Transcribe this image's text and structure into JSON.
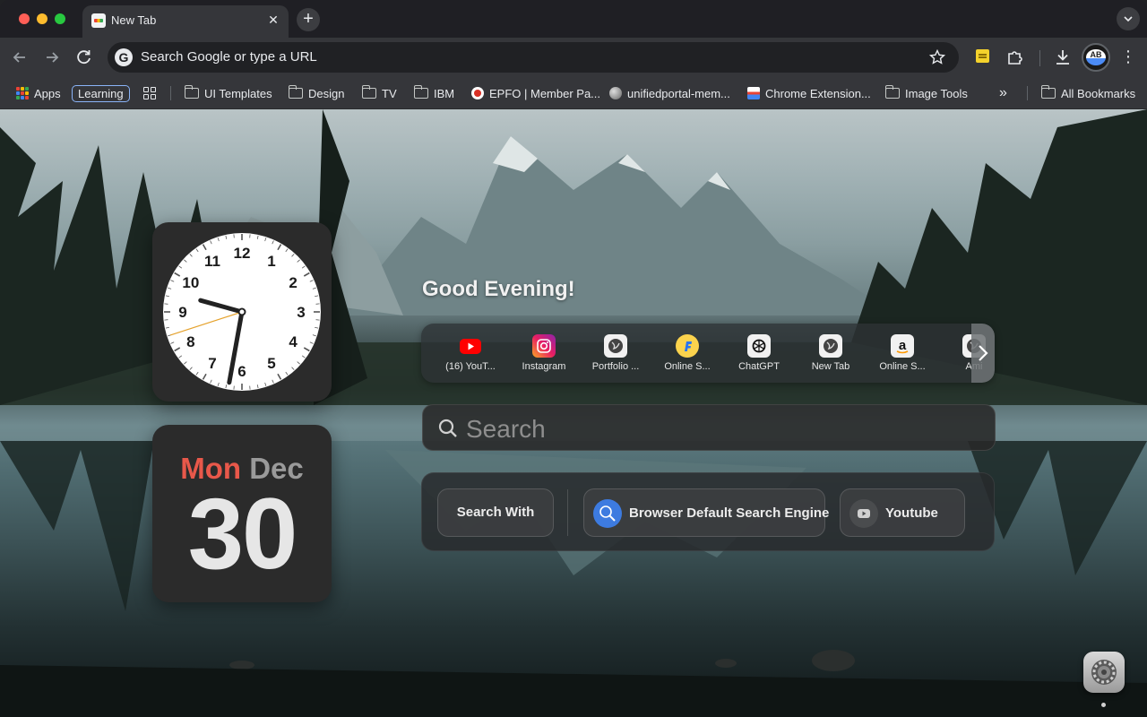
{
  "tab": {
    "title": "New Tab",
    "close": "✕",
    "new_tab": "+"
  },
  "omnibox": {
    "text": "Search Google or type a URL",
    "engine_letter": "G"
  },
  "profile": {
    "initials": "AB"
  },
  "bookmarks": {
    "apps": "Apps",
    "learning": "Learning",
    "items": [
      "UI Templates",
      "Design",
      "TV",
      "IBM",
      "EPFO | Member Pa...",
      "unifiedportal-mem...",
      "Chrome Extension...",
      "Image Tools"
    ],
    "overflow": "»",
    "all": "All Bookmarks"
  },
  "clock": {
    "numbers": [
      "12",
      "1",
      "2",
      "3",
      "4",
      "5",
      "6",
      "7",
      "8",
      "9",
      "10",
      "11"
    ],
    "time": "21:31:42"
  },
  "calendar": {
    "day": "Mon",
    "month": "Dec",
    "date": "30"
  },
  "greeting": "Good Evening!",
  "shortcuts": [
    {
      "label": "(16) YouT...",
      "icon": "youtube-icon"
    },
    {
      "label": "Instagram",
      "icon": "instagram-icon"
    },
    {
      "label": "Portfolio ...",
      "icon": "globe-icon"
    },
    {
      "label": "Online S...",
      "icon": "flipkart-icon"
    },
    {
      "label": "ChatGPT",
      "icon": "chatgpt-icon"
    },
    {
      "label": "New Tab",
      "icon": "globe-icon"
    },
    {
      "label": "Online S...",
      "icon": "amazon-icon"
    },
    {
      "label": "Ami",
      "icon": "globe-icon"
    }
  ],
  "search": {
    "placeholder": "Search"
  },
  "engines": {
    "search_with": "Search With",
    "default": "Browser Default Search Engine",
    "youtube": "Youtube"
  },
  "colors": {
    "accent": "#e8584a",
    "chrome_bg": "#35363a"
  }
}
